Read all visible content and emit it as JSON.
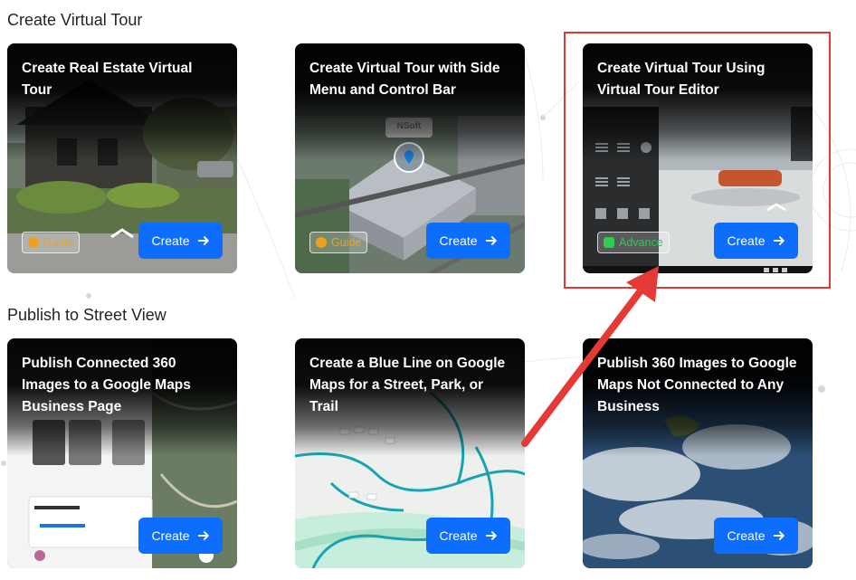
{
  "sections": {
    "virtual_tour": "Create Virtual Tour",
    "street_view": "Publish to Street View"
  },
  "cards": [
    {
      "title": "Create Real Estate Virtual Tour",
      "badge": "Guide",
      "button": "Create"
    },
    {
      "title": "Create Virtual Tour with Side Menu and Control Bar",
      "badge": "Guide",
      "button": "Create",
      "map_pin_label": "NSoft"
    },
    {
      "title": "Create Virtual Tour Using Virtual Tour Editor",
      "badge": "Advance",
      "button": "Create"
    },
    {
      "title": "Publish Connected 360 Images to a Google Maps Business Page",
      "button": "Create"
    },
    {
      "title": "Create a Blue Line on Google Maps for a Street, Park, or Trail",
      "button": "Create"
    },
    {
      "title": "Publish 360 Images to Google Maps Not Connected to Any Business",
      "button": "Create"
    }
  ],
  "colors": {
    "primary": "#0d6efd",
    "guide": "#f0a020",
    "advance": "#2ecc50",
    "annotation": "#e53935"
  }
}
